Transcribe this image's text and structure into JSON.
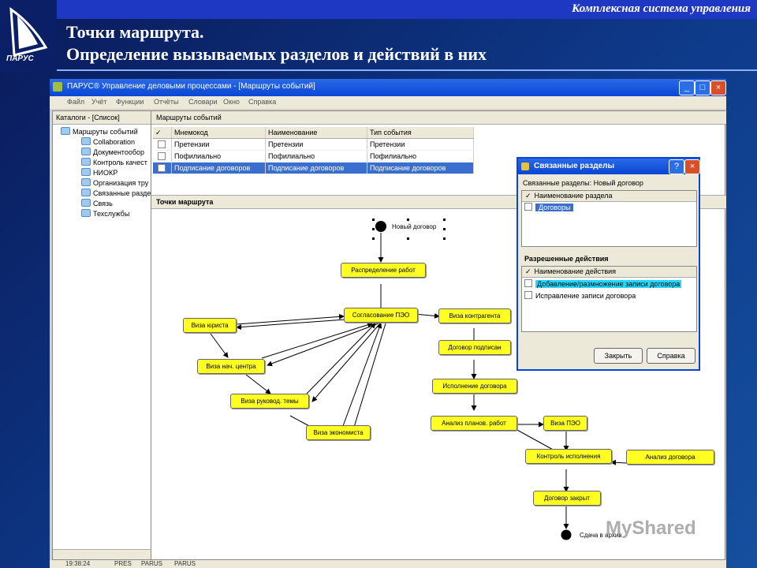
{
  "header": {
    "banner": "Комплексная система управления",
    "logo_text": "ПАРУС",
    "title": "Точки маршрута.",
    "subtitle": "Определение вызываемых разделов и действий в них"
  },
  "app": {
    "window_title": "ПАРУС® Управление деловыми процессами - [Маршруты событий]",
    "menu": [
      "Файл",
      "Учёт",
      "Функции",
      "Отчёты",
      "Словари",
      "Окно",
      "Справка"
    ],
    "catalog_title": "Каталоги - [Список]",
    "tree": {
      "root": "Маршруты событий",
      "items": [
        "Collaboration",
        "Документообор",
        "Контроль качест",
        "НИОКР",
        "Организация тру",
        "Связанные разде",
        "Связь",
        "Техслужбы"
      ]
    },
    "events_title": "Маршруты событий",
    "events_columns": [
      "Мнемокод",
      "Наименование",
      "Тип события"
    ],
    "events_rows": [
      [
        "Претензии",
        "Претензии",
        "Претензии"
      ],
      [
        "Пофилиально",
        "Пофилиально",
        "Пофилиально"
      ],
      [
        "Подписание договоров",
        "Подписание договоров",
        "Подписание договоров"
      ]
    ],
    "points_title": "Точки маршрута",
    "status": [
      "19:38:24",
      "PRES",
      "PARUS",
      "PARUS"
    ]
  },
  "diagram": {
    "start_label": "Новый договор",
    "end_label": "Сдача в архив",
    "nodes": {
      "n1": "Распределение работ",
      "n2": "Согласование ПЭО",
      "n3": "Виза юриста",
      "n4": "Виза нач. центра",
      "n5": "Виза руковод. темы",
      "n6": "Виза экономиста",
      "n7": "Виза контрагента",
      "n8": "Договор подписан",
      "n9": "Исполнение договора",
      "n10": "Анализ планов. работ",
      "n11": "Виза ПЭО",
      "n12": "Контроль исполнения",
      "n13": "Анализ договора",
      "n14": "Договор закрыт"
    }
  },
  "dialog": {
    "title": "Связанные разделы",
    "subtitle": "Связанные разделы: Новый договор",
    "sections_header": "Наименование раздела",
    "sections": [
      "Договоры"
    ],
    "actions_title": "Разрешенные действия",
    "actions_header": "Наименование действия",
    "actions": [
      "Добавление/размножение записи договора",
      "Исправление записи договора"
    ],
    "close_label": "Закрыть",
    "help_label": "Справка"
  },
  "watermark": "MyShared"
}
